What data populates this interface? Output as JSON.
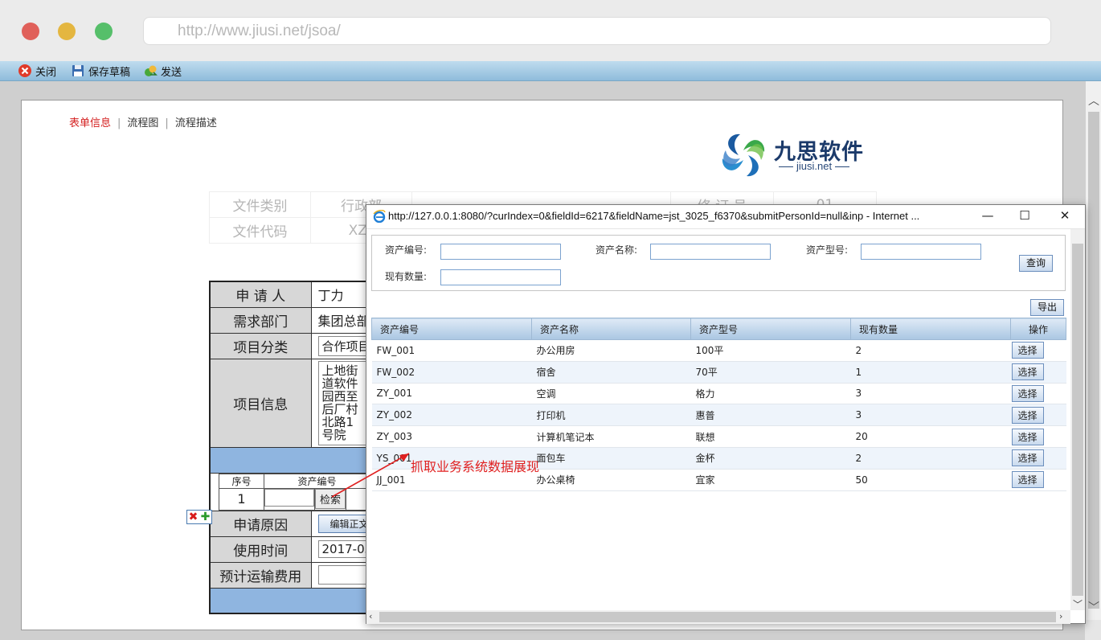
{
  "browser": {
    "url": "http://www.jiusi.net/jsoa/"
  },
  "toolbar": {
    "close_label": "关闭",
    "save_label": "保存草稿",
    "send_label": "发送"
  },
  "tabs": [
    {
      "label": "表单信息"
    },
    {
      "label": "流程图"
    },
    {
      "label": "流程描述"
    }
  ],
  "logo": {
    "name": "九思软件",
    "sub": "jiusi.net"
  },
  "info_table": {
    "r1c1": "文件类别",
    "r1c2": "行政部",
    "r1c3": "修 订 号",
    "r1c4": "01",
    "r2c1": "文件代码",
    "r2c2": "XZ_"
  },
  "form": {
    "applicant_label": "申 请 人",
    "applicant_value": "丁力",
    "dept_label": "需求部门",
    "dept_value": "集团总部",
    "category_label": "项目分类",
    "category_value": "合作项目",
    "project_label": "项目信息",
    "project_value": "上地街道软件园西至后厂村北路1号院",
    "sub_headers": [
      "序号",
      "资产编号"
    ],
    "sub_row_no": "1",
    "search_label": "检索",
    "reason_label": "申请原因",
    "reason_btn": "编辑正文",
    "time_label": "使用时间",
    "time_value": "2017-03-",
    "cost_label": "预计运输费用"
  },
  "popup": {
    "title": "http://127.0.0.1:8080/?curIndex=0&fieldId=6217&fieldName=jst_3025_f6370&submitPersonId=null&inp - Internet ...",
    "search": {
      "asset_no_label": "资产编号:",
      "asset_name_label": "资产名称:",
      "asset_model_label": "资产型号:",
      "qty_label": "现有数量:",
      "query_btn": "查询"
    },
    "export_btn": "导出",
    "columns": [
      "资产编号",
      "资产名称",
      "资产型号",
      "现有数量",
      "操作"
    ],
    "pick_label": "选择",
    "rows": [
      {
        "no": "FW_001",
        "name": "办公用房",
        "model": "100平",
        "qty": "2"
      },
      {
        "no": "FW_002",
        "name": "宿舍",
        "model": "70平",
        "qty": "1"
      },
      {
        "no": "ZY_001",
        "name": "空调",
        "model": "格力",
        "qty": "3"
      },
      {
        "no": "ZY_002",
        "name": "打印机",
        "model": "惠普",
        "qty": "3"
      },
      {
        "no": "ZY_003",
        "name": "计算机笔记本",
        "model": "联想",
        "qty": "20"
      },
      {
        "no": "YS_001",
        "name": "面包车",
        "model": "金杯",
        "qty": "2"
      },
      {
        "no": "JJ_001",
        "name": "办公桌椅",
        "model": "宜家",
        "qty": "50"
      }
    ]
  },
  "annotation": "抓取业务系统数据展现",
  "colors": {
    "accent_red": "#d42020",
    "header_blue": "#8fb5e0",
    "toolbar_blue": "#9fc6e0"
  },
  "icons": [
    "close-icon",
    "save-icon",
    "send-icon",
    "ie-icon",
    "minimize-icon",
    "maximize-icon",
    "window-close-icon",
    "delete-row-icon",
    "add-row-icon",
    "logo-mark-icon"
  ]
}
